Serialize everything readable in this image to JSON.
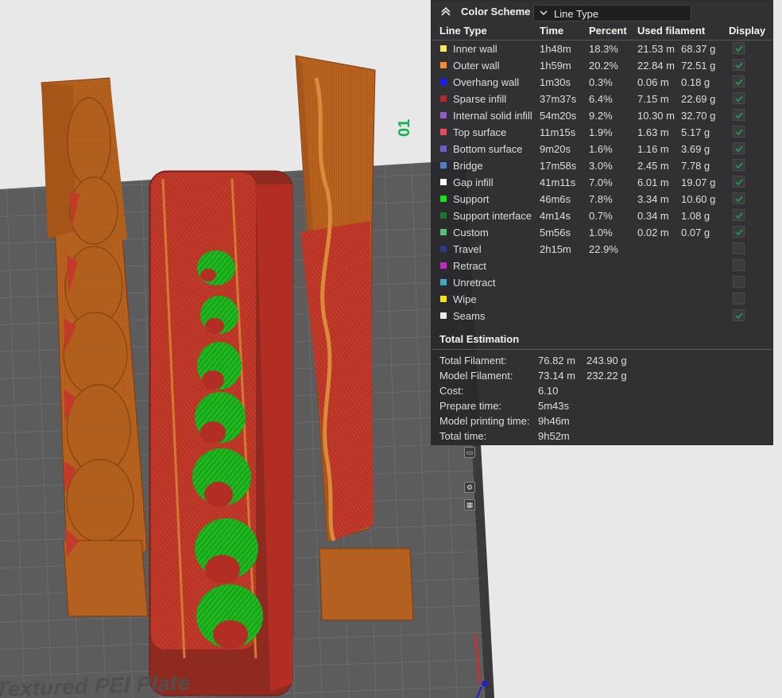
{
  "viewport": {
    "plate_label": "Textured PEI Plate",
    "plate_number": "01"
  },
  "panel": {
    "title": "Color Scheme",
    "scheme_value": "Line Type",
    "headers": {
      "line_type": "Line Type",
      "time": "Time",
      "percent": "Percent",
      "used_filament": "Used filament",
      "display": "Display"
    },
    "rows": [
      {
        "name": "Inner wall",
        "color": "#ffe65a",
        "time": "1h48m",
        "percent": "18.3%",
        "length": "21.53 m",
        "weight": "68.37 g",
        "display": true
      },
      {
        "name": "Outer wall",
        "color": "#ff8a2e",
        "time": "1h59m",
        "percent": "20.2%",
        "length": "22.84 m",
        "weight": "72.51 g",
        "display": true
      },
      {
        "name": "Overhang wall",
        "color": "#1a1aff",
        "time": "1m30s",
        "percent": "0.3%",
        "length": "0.06 m",
        "weight": "0.18 g",
        "display": true
      },
      {
        "name": "Sparse infill",
        "color": "#b02a2a",
        "time": "37m37s",
        "percent": "6.4%",
        "length": "7.15 m",
        "weight": "22.69 g",
        "display": true
      },
      {
        "name": "Internal solid infill",
        "color": "#9a59c9",
        "time": "54m20s",
        "percent": "9.2%",
        "length": "10.30 m",
        "weight": "32.70 g",
        "display": true
      },
      {
        "name": "Top surface",
        "color": "#e84c5a",
        "time": "11m15s",
        "percent": "1.9%",
        "length": "1.63 m",
        "weight": "5.17 g",
        "display": true
      },
      {
        "name": "Bottom surface",
        "color": "#6b5bd1",
        "time": "9m20s",
        "percent": "1.6%",
        "length": "1.16 m",
        "weight": "3.69 g",
        "display": true
      },
      {
        "name": "Bridge",
        "color": "#4d7fc9",
        "time": "17m58s",
        "percent": "3.0%",
        "length": "2.45 m",
        "weight": "7.78 g",
        "display": true
      },
      {
        "name": "Gap infill",
        "color": "#ffffff",
        "time": "41m11s",
        "percent": "7.0%",
        "length": "6.01 m",
        "weight": "19.07 g",
        "display": true
      },
      {
        "name": "Support",
        "color": "#19e019",
        "time": "46m6s",
        "percent": "7.8%",
        "length": "3.34 m",
        "weight": "10.60 g",
        "display": true
      },
      {
        "name": "Support interface",
        "color": "#127a2a",
        "time": "4m14s",
        "percent": "0.7%",
        "length": "0.34 m",
        "weight": "1.08 g",
        "display": true
      },
      {
        "name": "Custom",
        "color": "#52c27a",
        "time": "5m56s",
        "percent": "1.0%",
        "length": "0.02 m",
        "weight": "0.07 g",
        "display": true
      },
      {
        "name": "Travel",
        "color": "#2a3a8a",
        "time": "2h15m",
        "percent": "22.9%",
        "length": "",
        "weight": "",
        "display": false
      },
      {
        "name": "Retract",
        "color": "#c228c2",
        "time": "",
        "percent": "",
        "length": "",
        "weight": "",
        "display": false
      },
      {
        "name": "Unretract",
        "color": "#3fa8c2",
        "time": "",
        "percent": "",
        "length": "",
        "weight": "",
        "display": false
      },
      {
        "name": "Wipe",
        "color": "#f2e21a",
        "time": "",
        "percent": "",
        "length": "",
        "weight": "",
        "display": false
      },
      {
        "name": "Seams",
        "color": "#ececec",
        "time": "",
        "percent": "",
        "length": "",
        "weight": "",
        "display": true
      }
    ],
    "total": {
      "title": "Total Estimation",
      "rows": [
        {
          "label": "Total Filament:",
          "value": "76.82 m",
          "value2": "243.90 g"
        },
        {
          "label": "Model Filament:",
          "value": "73.14 m",
          "value2": "232.22 g"
        },
        {
          "label": "Cost:",
          "value": "6.10",
          "value2": ""
        },
        {
          "label": "Prepare time:",
          "value": "5m43s",
          "value2": ""
        },
        {
          "label": "Model printing time:",
          "value": "9h46m",
          "value2": ""
        },
        {
          "label": "Total time:",
          "value": "9h52m",
          "value2": ""
        }
      ]
    }
  }
}
